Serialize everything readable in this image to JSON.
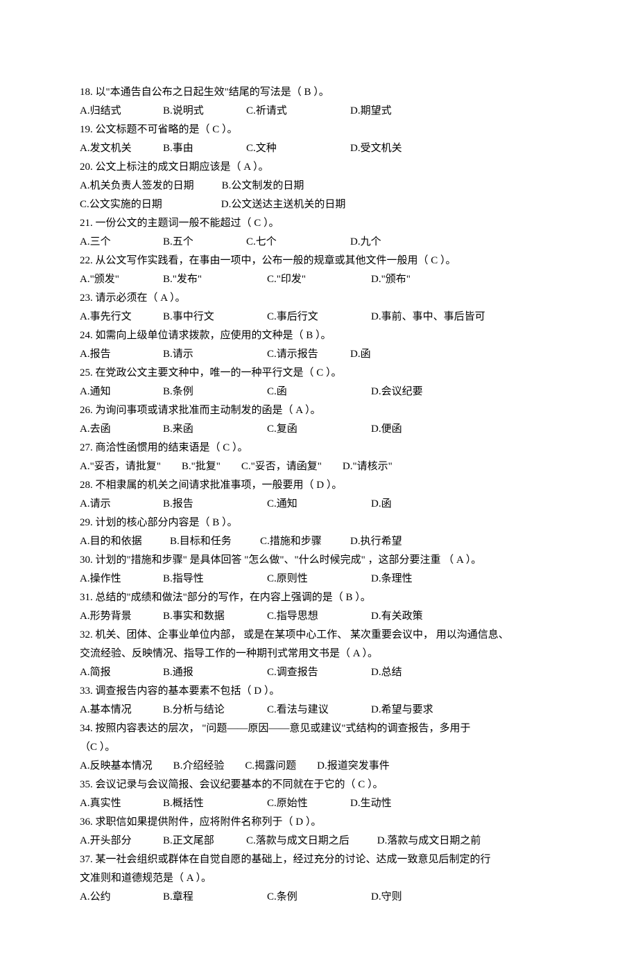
{
  "questions": [
    {
      "num": "18.",
      "text_before": "以\"本通告自公布之日起生效\"结尾的写法是（",
      "answer": "B",
      "text_after": "）。",
      "options": [
        {
          "letter": "A.",
          "text": "归结式",
          "w": "w1"
        },
        {
          "letter": "B.",
          "text": "说明式",
          "w": "w1"
        },
        {
          "letter": "C.",
          "text": "祈请式",
          "w": "w2"
        },
        {
          "letter": "D.",
          "text": "期望式",
          "w": ""
        }
      ]
    },
    {
      "num": "19.",
      "text_before": "公文标题不可省略的是（",
      "answer": "C",
      "text_after": "）。",
      "options": [
        {
          "letter": "A.",
          "text": "发文机关",
          "w": "w1"
        },
        {
          "letter": "B.",
          "text": "事由",
          "w": "w1"
        },
        {
          "letter": "C.",
          "text": "文种",
          "w": "w2"
        },
        {
          "letter": "D.",
          "text": "受文机关",
          "w": ""
        }
      ]
    },
    {
      "num": "20.",
      "text_before": "公文上标注的成文日期应该是（",
      "answer": "A",
      "text_after": "）。",
      "options_rows": [
        [
          {
            "letter": "A.",
            "text": "机关负责人签发的日期",
            "w": ""
          },
          {
            "letter": "B.",
            "text": "公文制发的日期",
            "w": "",
            "pad": 40
          }
        ],
        [
          {
            "letter": "C.",
            "text": "公文实施的日期",
            "w": ""
          },
          {
            "letter": "D.",
            "text": "公文送达主送机关的日期",
            "w": "",
            "pad": 85
          }
        ]
      ]
    },
    {
      "num": "21.",
      "text_before": "一份公文的主题词一般不能超过（",
      "answer": "C",
      "text_after": "）。",
      "options": [
        {
          "letter": "A.",
          "text": "三个",
          "w": "w1"
        },
        {
          "letter": "B.",
          "text": "五个",
          "w": "w1"
        },
        {
          "letter": "C.",
          "text": "七个",
          "w": "w2"
        },
        {
          "letter": "D.",
          "text": "九个",
          "w": ""
        }
      ]
    },
    {
      "num": "22.",
      "text_before": "从公文写作实践看，在事由一项中，公布一般的规章或其他文件一般用（",
      "answer": "C",
      "text_after": "）。",
      "options": [
        {
          "letter": "A.",
          "text": "\"颁发\"",
          "w": "w1"
        },
        {
          "letter": "B.",
          "text": "\"发布\"",
          "w": "w2"
        },
        {
          "letter": "C.",
          "text": "\"印发\"",
          "w": "w2"
        },
        {
          "letter": "D.",
          "text": "\"颁布\"",
          "w": ""
        }
      ]
    },
    {
      "num": "23.",
      "text_before": "请示必须在（",
      "answer": "A",
      "text_after": "）。",
      "options": [
        {
          "letter": "A.",
          "text": "事先行文",
          "w": "w1"
        },
        {
          "letter": "B.",
          "text": "事中行文",
          "w": "w2"
        },
        {
          "letter": "C.",
          "text": "事后行文",
          "w": "w2"
        },
        {
          "letter": "D.",
          "text": "事前、事中、事后皆可",
          "w": ""
        }
      ]
    },
    {
      "num": "24.",
      "text_before": "如需向上级单位请求拨款，应使用的文种是（",
      "answer": "B",
      "text_after": "）。",
      "options": [
        {
          "letter": "A.",
          "text": "报告",
          "w": "w1"
        },
        {
          "letter": "B.",
          "text": "请示",
          "w": "w2"
        },
        {
          "letter": "C.",
          "text": "请示报告",
          "w": "w1"
        },
        {
          "letter": "D.",
          "text": "函",
          "w": ""
        }
      ]
    },
    {
      "num": "25.",
      "text_before": "在党政公文主要文种中，唯一的一种平行文是（",
      "answer": "C",
      "text_after": "）。",
      "options": [
        {
          "letter": "A.",
          "text": "通知",
          "w": "w1"
        },
        {
          "letter": "B.",
          "text": "条例",
          "w": "w2"
        },
        {
          "letter": "C.",
          "text": "函",
          "w": "w2"
        },
        {
          "letter": "D.",
          "text": "会议纪要",
          "w": ""
        }
      ]
    },
    {
      "num": "26.",
      "text_before": "为询问事项或请求批准而主动制发的函是（",
      "answer": "A",
      "text_after": "）。",
      "options": [
        {
          "letter": "A.",
          "text": "去函",
          "w": "w1"
        },
        {
          "letter": "B.",
          "text": "来函",
          "w": "w2"
        },
        {
          "letter": "C.",
          "text": "复函",
          "w": "w2"
        },
        {
          "letter": "D.",
          "text": "便函",
          "w": ""
        }
      ]
    },
    {
      "num": "27.",
      "text_before": " 商洽性函惯用的结束语是（",
      "answer": "C",
      "text_after": "）。",
      "options": [
        {
          "letter": "A.",
          "text": "\"妥否，请批复\"",
          "w": ""
        },
        {
          "letter": "B.",
          "text": "\"批复\"",
          "w": "",
          "pad": 30
        },
        {
          "letter": "C.",
          "text": "\"妥否，请函复\"",
          "w": "",
          "pad": 30
        },
        {
          "letter": "D.",
          "text": "\"请核示\"",
          "w": "",
          "pad": 30
        }
      ]
    },
    {
      "num": "28.",
      "text_before": "不相隶属的机关之间请求批准事项，一般要用（",
      "answer": "D",
      "text_after": "）。",
      "options": [
        {
          "letter": "A.",
          "text": "请示",
          "w": "w1"
        },
        {
          "letter": "B.",
          "text": "报告",
          "w": "w2"
        },
        {
          "letter": "C.",
          "text": "通知",
          "w": "w2"
        },
        {
          "letter": "D.",
          "text": "函",
          "w": ""
        }
      ]
    },
    {
      "num": "29.",
      "text_before": "计划的核心部分内容是（",
      "answer": "B",
      "text_after": "）。",
      "options": [
        {
          "letter": "A.",
          "text": "目的和依据",
          "w": "w3"
        },
        {
          "letter": "B.",
          "text": "目标和任务",
          "w": "w3"
        },
        {
          "letter": "C.",
          "text": "措施和步骤",
          "w": "w3"
        },
        {
          "letter": "D.",
          "text": "执行希望",
          "w": ""
        }
      ]
    },
    {
      "num": "30.",
      "text_before": "计划的\"措施和步骤\"  是具体回答  \"怎么做\"、\"什么时候完成\" ，这部分要注重  （  A",
      "answer": "",
      "text_after": "  ）。",
      "options": [
        {
          "letter": "A.",
          "text": "操作性",
          "w": "w1"
        },
        {
          "letter": "B.",
          "text": "指导性",
          "w": "w2"
        },
        {
          "letter": "C.",
          "text": "原则性",
          "w": "w2"
        },
        {
          "letter": "D.",
          "text": "条理性",
          "w": ""
        }
      ]
    },
    {
      "num": "31.",
      "text_before": "总结的\"成绩和做法\"部分的写作，在内容上强调的是（",
      "answer": "B",
      "text_after": "）。",
      "options": [
        {
          "letter": "A.",
          "text": "形势背景",
          "w": "w1"
        },
        {
          "letter": "B.",
          "text": "事实和数据",
          "w": "w2"
        },
        {
          "letter": "C.",
          "text": "指导思想",
          "w": "w2"
        },
        {
          "letter": "D.",
          "text": "有关政策",
          "w": ""
        }
      ]
    },
    {
      "num": "32.",
      "text_before_lines": [
        "机关、团体、企事业单位内部，  或是在某项中心工作、  某次重要会议中，  用以沟通信息、",
        "交流经验、反映情况、指导工作的一种期刊式常用文书是（"
      ],
      "answer": "A",
      "text_after": "）。",
      "options": [
        {
          "letter": "A.",
          "text": "简报",
          "w": "w1"
        },
        {
          "letter": "B.",
          "text": "通报",
          "w": "w2"
        },
        {
          "letter": "C.",
          "text": "调查报告",
          "w": "w2"
        },
        {
          "letter": "D.",
          "text": "总结",
          "w": ""
        }
      ]
    },
    {
      "num": "33.",
      "text_before": "调查报告内容的基本要素不包括（",
      "answer": "D",
      "text_after": "）。",
      "options": [
        {
          "letter": "A.",
          "text": "基本情况",
          "w": "w1"
        },
        {
          "letter": "B.",
          "text": "分析与结论",
          "w": "w2"
        },
        {
          "letter": "C.",
          "text": "看法与建议",
          "w": "w2"
        },
        {
          "letter": "D.",
          "text": "希望与要求",
          "w": ""
        }
      ]
    },
    {
      "num": "34.",
      "text_before_lines": [
        "按照内容表达的层次，   \"问题——原因——意见或建议\"式结构的调查报告，多用于"
      ],
      "answer_line": "（C    ）。",
      "options": [
        {
          "letter": "A.",
          "text": "反映基本情况",
          "w": ""
        },
        {
          "letter": "B.",
          "text": "介绍经验",
          "w": "",
          "pad": 30
        },
        {
          "letter": "C.",
          "text": "揭露问题",
          "w": "",
          "pad": 30
        },
        {
          "letter": "D.",
          "text": "报道突发事件",
          "w": "",
          "pad": 30
        }
      ]
    },
    {
      "num": "35.",
      "text_before": "会议记录与会议简报、会议纪要基本的不同就在于它的（",
      "answer": "C",
      "text_after": "）。",
      "options": [
        {
          "letter": "A.",
          "text": "真实性",
          "w": "w1"
        },
        {
          "letter": "B.",
          "text": "概括性",
          "w": "w2"
        },
        {
          "letter": "C.",
          "text": "原始性",
          "w": "w1"
        },
        {
          "letter": "D.",
          "text": "生动性",
          "w": ""
        }
      ]
    },
    {
      "num": "36.",
      "text_before": "求职信如果提供附件，应将附件名称列于（",
      "answer": "D",
      "text_after": "）。",
      "options": [
        {
          "letter": "A.",
          "text": "开头部分",
          "w": "w1"
        },
        {
          "letter": "B.",
          "text": "正文尾部",
          "w": "w1"
        },
        {
          "letter": "C.",
          "text": "落款与成文日期之后",
          "w": ""
        },
        {
          "letter": "D.",
          "text": "落款与成文日期之前",
          "w": "",
          "pad": 40
        }
      ]
    },
    {
      "num": "37.",
      "text_before_lines": [
        "某一社会组织或群体在自觉自愿的基础上，经过充分的讨论、达成一致意见后制定的行",
        "文准则和道德规范是（"
      ],
      "answer": "A",
      "text_after": "）。",
      "options": [
        {
          "letter": "A.",
          "text": "公约",
          "w": "w1"
        },
        {
          "letter": "B.",
          "text": "章程",
          "w": "w2"
        },
        {
          "letter": "C.",
          "text": "条例",
          "w": "w2"
        },
        {
          "letter": "D.",
          "text": "守则",
          "w": ""
        }
      ]
    }
  ]
}
